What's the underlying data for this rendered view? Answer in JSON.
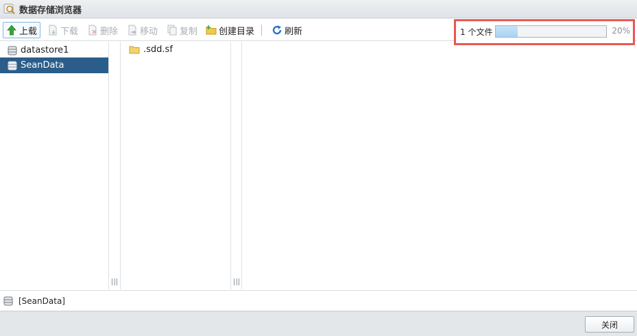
{
  "window": {
    "title": "数据存储浏览器"
  },
  "toolbar": {
    "upload": "上载",
    "download": "下载",
    "delete": "删除",
    "move": "移动",
    "copy": "复制",
    "create_dir": "创建目录",
    "refresh": "刷新"
  },
  "upload_status": {
    "file_count": "1 个文件",
    "progress_percent": 20,
    "progress_label": "20%"
  },
  "datastores": [
    {
      "name": "datastore1",
      "selected": false
    },
    {
      "name": "SeanData",
      "selected": true
    }
  ],
  "folders": [
    {
      "name": ".sdd.sf"
    }
  ],
  "status_path": "[SeanData]",
  "footer": {
    "close": "关闭"
  },
  "colors": {
    "selection": "#2b5d8a",
    "highlight_border": "#e9574f",
    "progress_fill": "#a9d2f2"
  }
}
